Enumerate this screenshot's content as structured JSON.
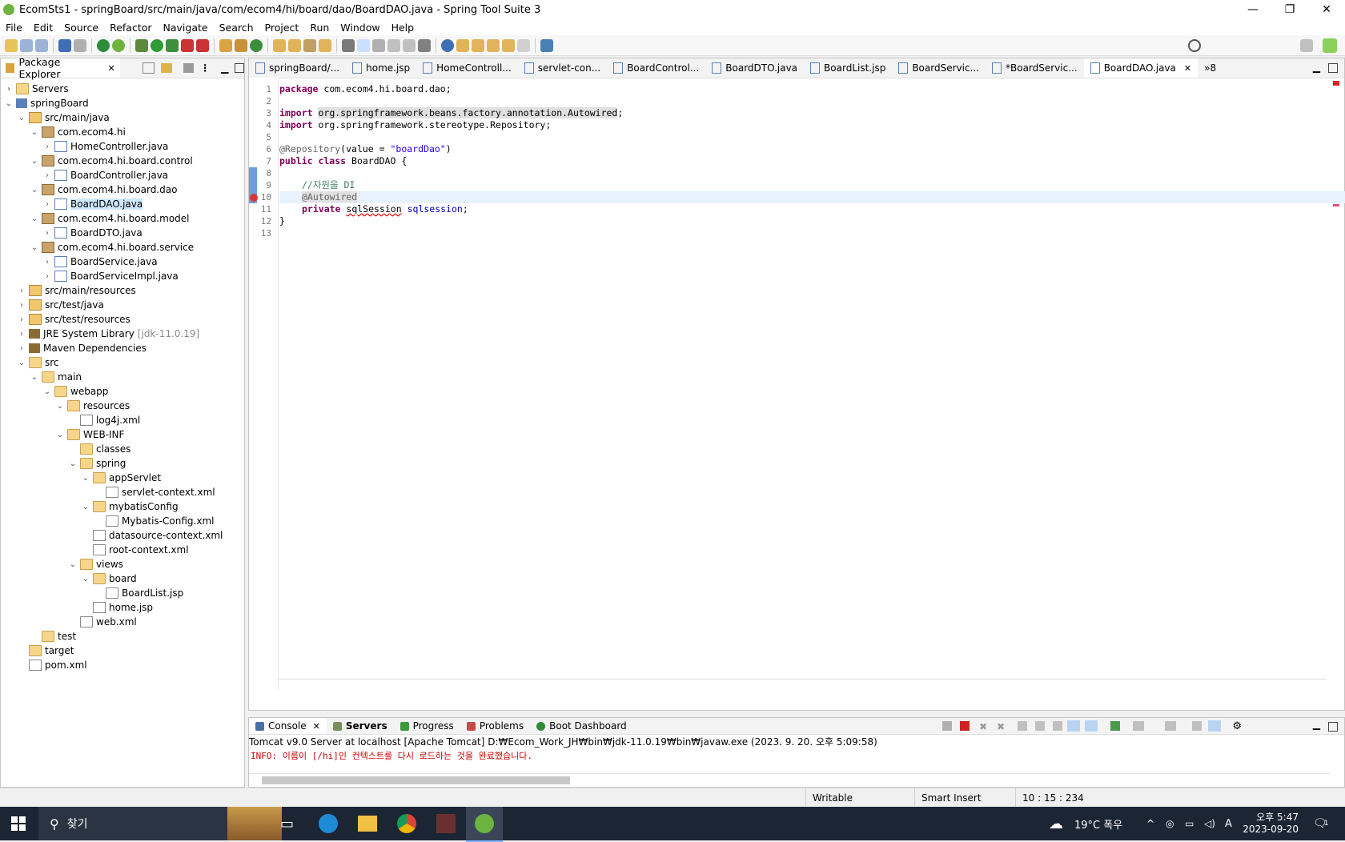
{
  "window": {
    "title": "EcomSts1 - springBoard/src/main/java/com/ecom4/hi/board/dao/BoardDAO.java - Spring Tool Suite 3",
    "buttons": {
      "minimize": "—",
      "restore": "❐",
      "close": "✕"
    }
  },
  "menu": [
    "File",
    "Edit",
    "Source",
    "Refactor",
    "Navigate",
    "Search",
    "Project",
    "Run",
    "Window",
    "Help"
  ],
  "package_explorer": {
    "title": "Package Explorer",
    "items": [
      {
        "label": "Servers",
        "tw": "›",
        "icon": "folder-icon"
      },
      {
        "label": "springBoard",
        "tw": "⌄",
        "icon": "project-icon"
      },
      {
        "label": "src/main/java",
        "tw": "⌄",
        "icon": "source-folder-icon"
      },
      {
        "label": "com.ecom4.hi",
        "tw": "⌄",
        "icon": "package-icon"
      },
      {
        "label": "HomeController.java",
        "tw": "›",
        "icon": "java-file-icon"
      },
      {
        "label": "com.ecom4.hi.board.control",
        "tw": "⌄",
        "icon": "package-icon"
      },
      {
        "label": "BoardController.java",
        "tw": "›",
        "icon": "java-file-icon"
      },
      {
        "label": "com.ecom4.hi.board.dao",
        "tw": "⌄",
        "icon": "package-icon"
      },
      {
        "label": "BoardDAO.java",
        "tw": "›",
        "icon": "java-file-icon"
      },
      {
        "label": "com.ecom4.hi.board.model",
        "tw": "⌄",
        "icon": "package-icon"
      },
      {
        "label": "BoardDTO.java",
        "tw": "›",
        "icon": "java-file-icon"
      },
      {
        "label": "com.ecom4.hi.board.service",
        "tw": "⌄",
        "icon": "package-icon"
      },
      {
        "label": "BoardService.java",
        "tw": "›",
        "icon": "java-file-icon"
      },
      {
        "label": "BoardServiceImpl.java",
        "tw": "›",
        "icon": "java-file-icon"
      },
      {
        "label": "src/main/resources",
        "tw": "›",
        "icon": "source-folder-icon"
      },
      {
        "label": "src/test/java",
        "tw": "›",
        "icon": "source-folder-icon"
      },
      {
        "label": "src/test/resources",
        "tw": "›",
        "icon": "source-folder-icon"
      },
      {
        "label": "JRE System Library",
        "suffix": "[jdk-11.0.19]",
        "tw": "›",
        "icon": "library-icon"
      },
      {
        "label": "Maven Dependencies",
        "tw": "›",
        "icon": "library-icon"
      },
      {
        "label": "src",
        "tw": "⌄",
        "icon": "folder-icon"
      },
      {
        "label": "main",
        "tw": "⌄",
        "icon": "folder-icon"
      },
      {
        "label": "webapp",
        "tw": "⌄",
        "icon": "folder-icon"
      },
      {
        "label": "resources",
        "tw": "⌄",
        "icon": "folder-icon"
      },
      {
        "label": "log4j.xml",
        "tw": "",
        "icon": "xml-file-icon"
      },
      {
        "label": "WEB-INF",
        "tw": "⌄",
        "icon": "folder-icon"
      },
      {
        "label": "classes",
        "tw": "",
        "icon": "folder-icon"
      },
      {
        "label": "spring",
        "tw": "⌄",
        "icon": "folder-icon"
      },
      {
        "label": "appServlet",
        "tw": "⌄",
        "icon": "folder-icon"
      },
      {
        "label": "servlet-context.xml",
        "tw": "",
        "icon": "xml-file-icon"
      },
      {
        "label": "mybatisConfig",
        "tw": "⌄",
        "icon": "folder-icon"
      },
      {
        "label": "Mybatis-Config.xml",
        "tw": "",
        "icon": "xml-file-icon"
      },
      {
        "label": "datasource-context.xml",
        "tw": "",
        "icon": "xml-file-icon"
      },
      {
        "label": "root-context.xml",
        "tw": "",
        "icon": "xml-file-icon"
      },
      {
        "label": "views",
        "tw": "⌄",
        "icon": "folder-icon"
      },
      {
        "label": "board",
        "tw": "⌄",
        "icon": "folder-icon"
      },
      {
        "label": "BoardList.jsp",
        "tw": "",
        "icon": "jsp-file-icon"
      },
      {
        "label": "home.jsp",
        "tw": "",
        "icon": "jsp-file-icon"
      },
      {
        "label": "web.xml",
        "tw": "",
        "icon": "xml-file-icon"
      },
      {
        "label": "test",
        "tw": "",
        "icon": "folder-icon"
      },
      {
        "label": "target",
        "tw": "",
        "icon": "folder-icon"
      },
      {
        "label": "pom.xml",
        "tw": "",
        "icon": "maven-file-icon"
      }
    ]
  },
  "editor": {
    "tabs": [
      "springBoard/...",
      "home.jsp",
      "HomeControll...",
      "servlet-con...",
      "BoardControl...",
      "BoardDTO.java",
      "BoardList.jsp",
      "BoardServic...",
      "*BoardServic...",
      "BoardDAO.java"
    ],
    "overflow": "»8",
    "lines": [
      "1",
      "2",
      "3",
      "4",
      "5",
      "6",
      "7",
      "8",
      "9",
      "10",
      "11",
      "12",
      "13"
    ],
    "code": {
      "l1_kw": "package",
      "l1_rest": " com.ecom4.hi.board.dao;",
      "l3_kw": "import",
      "l3_rest": "org.springframework.beans.factory.annotation.Autowired",
      "l4_kw": "import",
      "l4_rest": " org.springframework.stereotype.Repository;",
      "l6_ann": "@Repository",
      "l6_mid": "(value = ",
      "l6_str": "\"boardDao\"",
      "l6_end": ")",
      "l7_kw": "public class",
      "l7_rest": " BoardDAO {",
      "l9_cm": "//자원을 DI",
      "l10_ann": "@Autowired",
      "l11_kw": "private",
      "l11_type": "sqlSession",
      "l11_field": "sqlsession",
      "l12": "}"
    }
  },
  "console": {
    "tabs": [
      "Console",
      "Servers",
      "Progress",
      "Problems",
      "Boot Dashboard"
    ],
    "header": "Tomcat v9.0 Server at localhost [Apache Tomcat] D:₩Ecom_Work_JH₩bin₩jdk-11.0.19₩bin₩javaw.exe  (2023. 9. 20. 오후 5:09:58)",
    "message": "INFO: 이름이 [/hi]인 컨텍스트를 다시 로드하는 것을 완료했습니다."
  },
  "status": {
    "writable": "Writable",
    "insert": "Smart Insert",
    "position": "10 : 15 : 234"
  },
  "taskbar": {
    "search_placeholder": "찾기",
    "weather": "19°C 폭우",
    "ime": "A",
    "time": "오후 5:47",
    "date": "2023-09-20",
    "notification_count": "1"
  },
  "colors": {
    "spring_green": "#6db33f",
    "keyword": "#7f0055",
    "comment": "#3f7f5f",
    "string": "#2a00ff",
    "console_error": "#cc0000"
  }
}
